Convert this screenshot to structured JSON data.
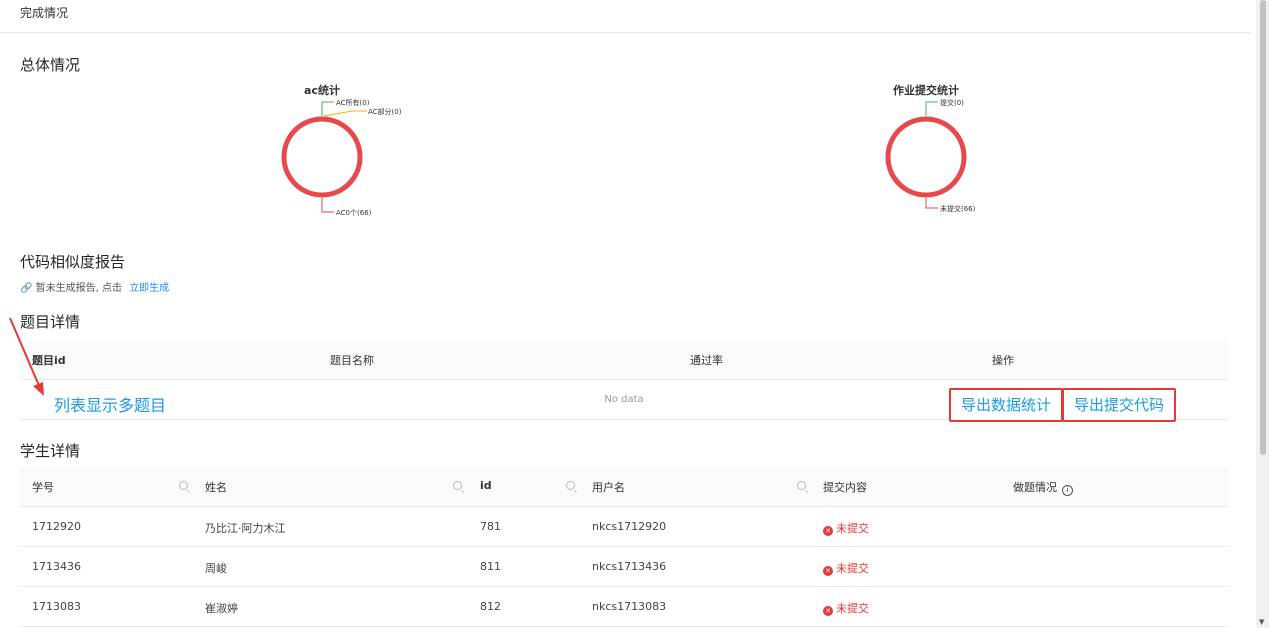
{
  "header": {
    "title": "完成情况"
  },
  "overview": {
    "title": "总体情况",
    "charts": [
      {
        "title": "ac统计",
        "ring_color": "#e8474b",
        "labels": [
          "AC所有(0)",
          "AC部分(0)",
          "AC0个(66)"
        ],
        "label_colors": [
          "#4caf50",
          "#f0b400",
          "#e8474b"
        ]
      },
      {
        "title": "作业提交统计",
        "ring_color": "#e8474b",
        "labels": [
          "提交(0)",
          "未提交(66)"
        ],
        "label_colors": [
          "#4caf50",
          "#e8474b"
        ]
      }
    ]
  },
  "chart_data": [
    {
      "type": "pie",
      "title": "ac统计",
      "categories": [
        "AC所有",
        "AC部分",
        "AC0个"
      ],
      "values": [
        0,
        0,
        66
      ]
    },
    {
      "type": "pie",
      "title": "作业提交统计",
      "categories": [
        "提交",
        "未提交"
      ],
      "values": [
        0,
        66
      ]
    }
  ],
  "similarity": {
    "title": "代码相似度报告",
    "text": "暂未生成报告, 点击",
    "link": "立即生成"
  },
  "problems": {
    "title": "题目详情",
    "columns": [
      "题目id",
      "题目名称",
      "通过率",
      "操作"
    ],
    "empty": "No data",
    "annotation": "列表显示多题目",
    "export_stats": "导出数据统计",
    "export_code": "导出提交代码"
  },
  "students": {
    "title": "学生详情",
    "columns": [
      "学号",
      "姓名",
      "id",
      "用户名",
      "提交内容",
      "做题情况"
    ],
    "rows": [
      {
        "no": "1712920",
        "name": "乃比江·阿力木江",
        "id": "781",
        "user": "nkcs1712920",
        "status": "未提交"
      },
      {
        "no": "1713436",
        "name": "周峻",
        "id": "811",
        "user": "nkcs1713436",
        "status": "未提交"
      },
      {
        "no": "1713083",
        "name": "崔淑婷",
        "id": "812",
        "user": "nkcs1713083",
        "status": "未提交"
      }
    ]
  }
}
